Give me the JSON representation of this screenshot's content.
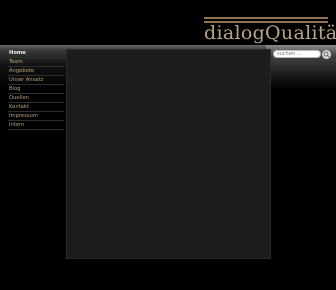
{
  "site": {
    "logo_text": "dialogQualität."
  },
  "search": {
    "placeholder": "suchen ..."
  },
  "nav": {
    "items": [
      {
        "label": "Home"
      },
      {
        "label": "Team"
      },
      {
        "label": "Angebote"
      },
      {
        "label": "Unser Ansatz"
      },
      {
        "label": "Blog"
      },
      {
        "label": "Quellen"
      },
      {
        "label": "Kontakt"
      },
      {
        "label": "Impressum"
      },
      {
        "label": "Intern"
      }
    ]
  },
  "colors": {
    "background": "#000000",
    "logo": "#b8a584",
    "nav_text": "#b8a07a",
    "nav_active": "#f0f0f0",
    "panel": "#1c1c1c"
  },
  "icons": {
    "search": "magnifier-icon"
  }
}
